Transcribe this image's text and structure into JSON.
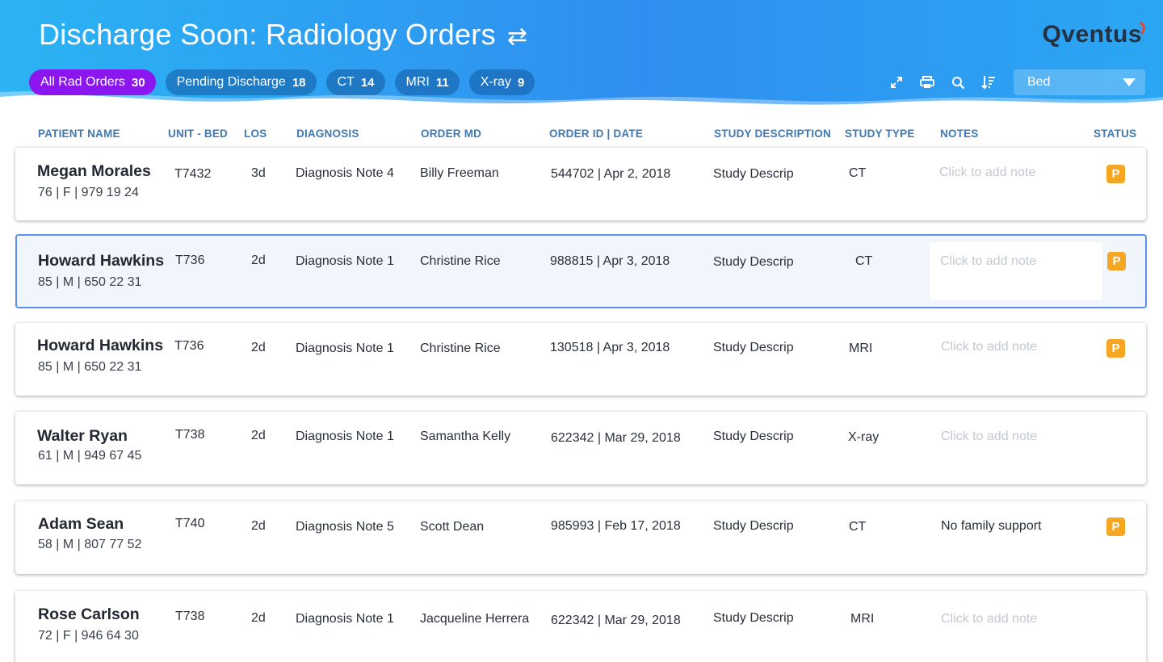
{
  "header": {
    "title": "Discharge Soon: Radiology Orders",
    "swap_icon": "swap-arrows-icon",
    "logo_text": "Qventus",
    "filters": [
      {
        "label": "All Rad Orders",
        "count": "30",
        "active": true
      },
      {
        "label": "Pending Discharge",
        "count": "18",
        "active": false
      },
      {
        "label": "CT",
        "count": "14",
        "active": false
      },
      {
        "label": "MRI",
        "count": "11",
        "active": false
      },
      {
        "label": "X-ray",
        "count": "9",
        "active": false
      }
    ],
    "tools": [
      "expand-icon",
      "print-icon",
      "search-icon",
      "sort-icon"
    ],
    "sort_select": {
      "value": "Bed"
    }
  },
  "columns": {
    "patient_name": "PATIENT NAME",
    "unit_bed": "UNIT - BED",
    "los": "LOS",
    "diagnosis": "DIAGNOSIS",
    "order_md": "ORDER MD",
    "order_id_date": "ORDER ID  |  DATE",
    "study_description": "STUDY  DESCRIPTION",
    "study_type": "STUDY  TYPE",
    "notes": "NOTES",
    "status": "STATUS"
  },
  "rows": [
    {
      "name": "Megan Morales",
      "meta": "76  |  F  | 979 19 24",
      "bed": "T7432",
      "los": "3d",
      "diagnosis": "Diagnosis Note 4",
      "md": "Billy Freeman",
      "order": "544702  | Apr 2, 2018",
      "study": "Study Descrip",
      "type": "CT",
      "note": "Click to add note",
      "note_is_placeholder": true,
      "status": "P",
      "selected": false
    },
    {
      "name": "Howard Hawkins",
      "meta": "85  |  M  | 650 22 31",
      "bed": "T736",
      "los": "2d",
      "diagnosis": "Diagnosis Note 1",
      "md": "Christine Rice",
      "order": "988815  |  Apr 3, 2018",
      "study": "Study Descrip",
      "type": "CT",
      "note": "Click to add note",
      "note_is_placeholder": true,
      "status": "P",
      "selected": true
    },
    {
      "name": "Howard Hawkins",
      "meta": "85  |  M  | 650 22 31",
      "bed": "T736",
      "los": "2d",
      "diagnosis": "Diagnosis Note 1",
      "md": "Christine Rice",
      "order": "130518  | Apr 3, 2018",
      "study": "Study Descrip",
      "type": "MRI",
      "note": "Click to add note",
      "note_is_placeholder": true,
      "status": "P",
      "selected": false
    },
    {
      "name": "Walter Ryan",
      "meta": "61  |  M  | 949 67 45",
      "bed": "T738",
      "los": "2d",
      "diagnosis": "Diagnosis Note 1",
      "md": "Samantha Kelly",
      "order": "622342 | Mar 29, 2018",
      "study": "Study Descrip",
      "type": "X-ray",
      "note": "Click to add note",
      "note_is_placeholder": true,
      "status": "",
      "selected": false
    },
    {
      "name": "Adam Sean",
      "meta": "58  |  M  | 807 77 52",
      "bed": "T740",
      "los": "2d",
      "diagnosis": "Diagnosis Note 5",
      "md": "Scott Dean",
      "order": "985993 | Feb 17, 2018",
      "study": "Study Descrip",
      "type": "CT",
      "note": "No family support",
      "note_is_placeholder": false,
      "status": "P",
      "selected": false
    },
    {
      "name": "Rose Carlson",
      "meta": "72  |  F  | 946 64 30",
      "bed": "T738",
      "los": "2d",
      "diagnosis": "Diagnosis Note 1",
      "md": "Jacqueline Herrera",
      "order": "622342 | Mar 29, 2018",
      "study": "Study Descrip",
      "type": "MRI",
      "note": "Click to add note",
      "note_is_placeholder": true,
      "status": "",
      "selected": false
    }
  ],
  "colors": {
    "accent_purple": "#8b16f0",
    "status_orange": "#f5a623",
    "header_blue": "#2f8ff0",
    "column_blue": "#3e79b5"
  }
}
